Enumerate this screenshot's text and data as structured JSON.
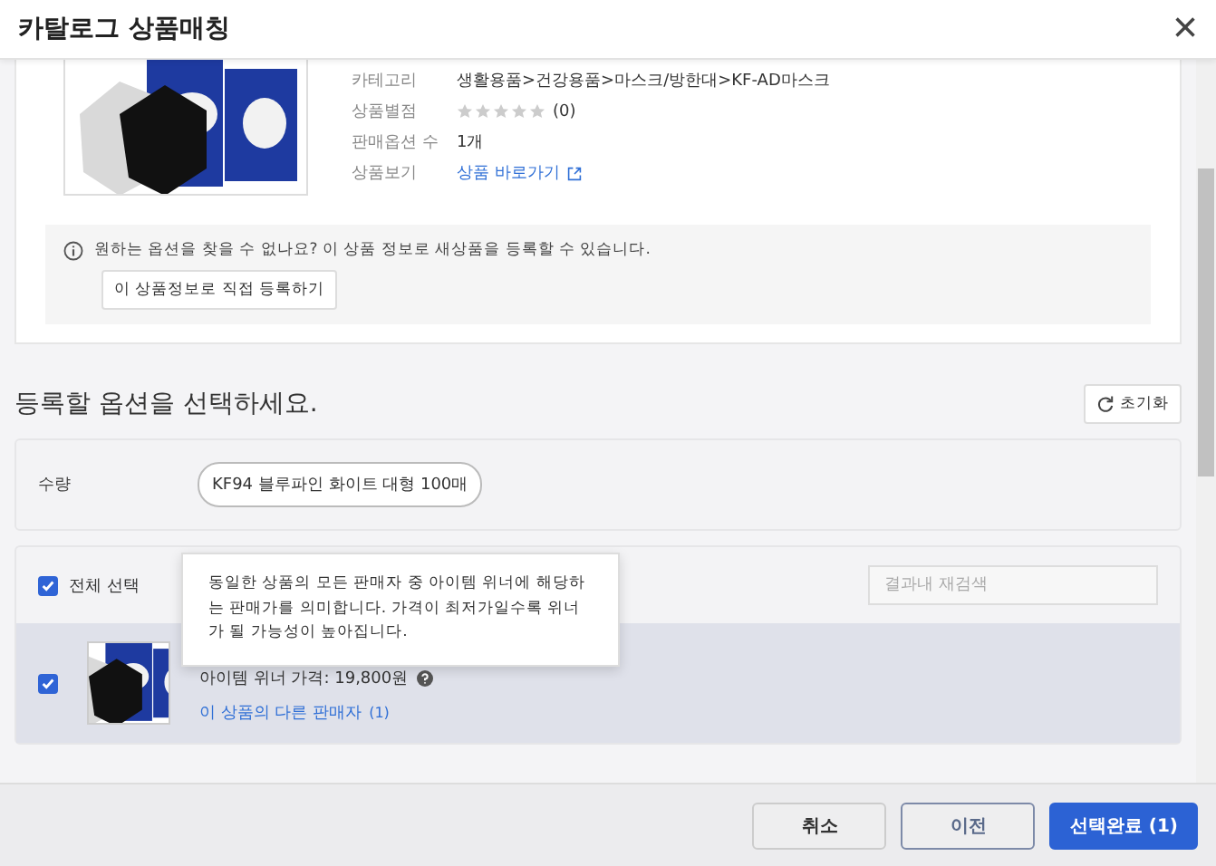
{
  "dialog": {
    "title": "카탈로그 상품매칭",
    "close": "×"
  },
  "product": {
    "details": [
      {
        "kind": "text",
        "label": "카테고리",
        "value": "생활용품>건강용품>마스크/방한대>KF-AD마스크"
      },
      {
        "kind": "stars",
        "label": "상품별점",
        "stars": 0,
        "count": "(0)"
      },
      {
        "kind": "text",
        "label": "판매옵션 수",
        "value": "1개"
      },
      {
        "kind": "link",
        "label": "상품보기",
        "value": "상품 바로가기"
      }
    ],
    "notice": {
      "message": "원하는 옵션을 찾을 수 없나요? 이 상품 정보로 새상품을 등록할 수 있습니다.",
      "button": "이 상품정보로 직접 등록하기"
    }
  },
  "options": {
    "heading": "등록할 옵션을 선택하세요.",
    "reset": "초기화",
    "quantity": {
      "label": "수량",
      "chips": [
        {
          "label": "KF94 블루파인 화이트 대형 100매",
          "selected": true
        }
      ]
    },
    "list": {
      "select_all": {
        "label": "전체 선택",
        "checked": true
      },
      "search": {
        "placeholder": "결과내 재검색"
      },
      "items": [
        {
          "checked": true,
          "price": "아이템 위너 가격: 19,800원",
          "link": "이 상품의 다른 판매자",
          "link_count": "(1)"
        }
      ]
    },
    "tooltip": "동일한 상품의 모든 판매자 중 아이템 위너에 해당하는 판매가를 의미합니다. 가격이 최저가일수록 위너가 될 가능성이 높아집니다."
  },
  "footer": {
    "buttons": [
      {
        "label": "취소",
        "kind": "plain"
      },
      {
        "label": "이전",
        "kind": "outline"
      },
      {
        "label": "선택완료 (1)",
        "kind": "primary"
      }
    ]
  }
}
